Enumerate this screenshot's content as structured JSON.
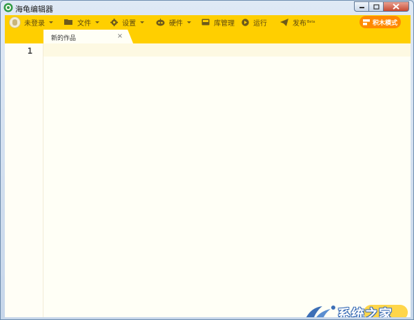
{
  "window": {
    "title": "海龟编辑器"
  },
  "toolbar": {
    "login_label": "未登录",
    "file_label": "文件",
    "settings_label": "设置",
    "hardware_label": "硬件",
    "library_label": "库管理",
    "run_label": "运行",
    "publish_label": "发布",
    "publish_badge": "Beta",
    "mode_button_label": "积木模式"
  },
  "tabs": [
    {
      "label": "新的作品",
      "close": "×"
    }
  ],
  "editor": {
    "line_numbers": [
      "1"
    ]
  },
  "watermark": {
    "text": "系统之家"
  },
  "colors": {
    "toolbar": "#ffcf00",
    "accent_button": "#ff8a00",
    "editor_bg": "#fffff6",
    "active_line": "#fdf9e2"
  }
}
